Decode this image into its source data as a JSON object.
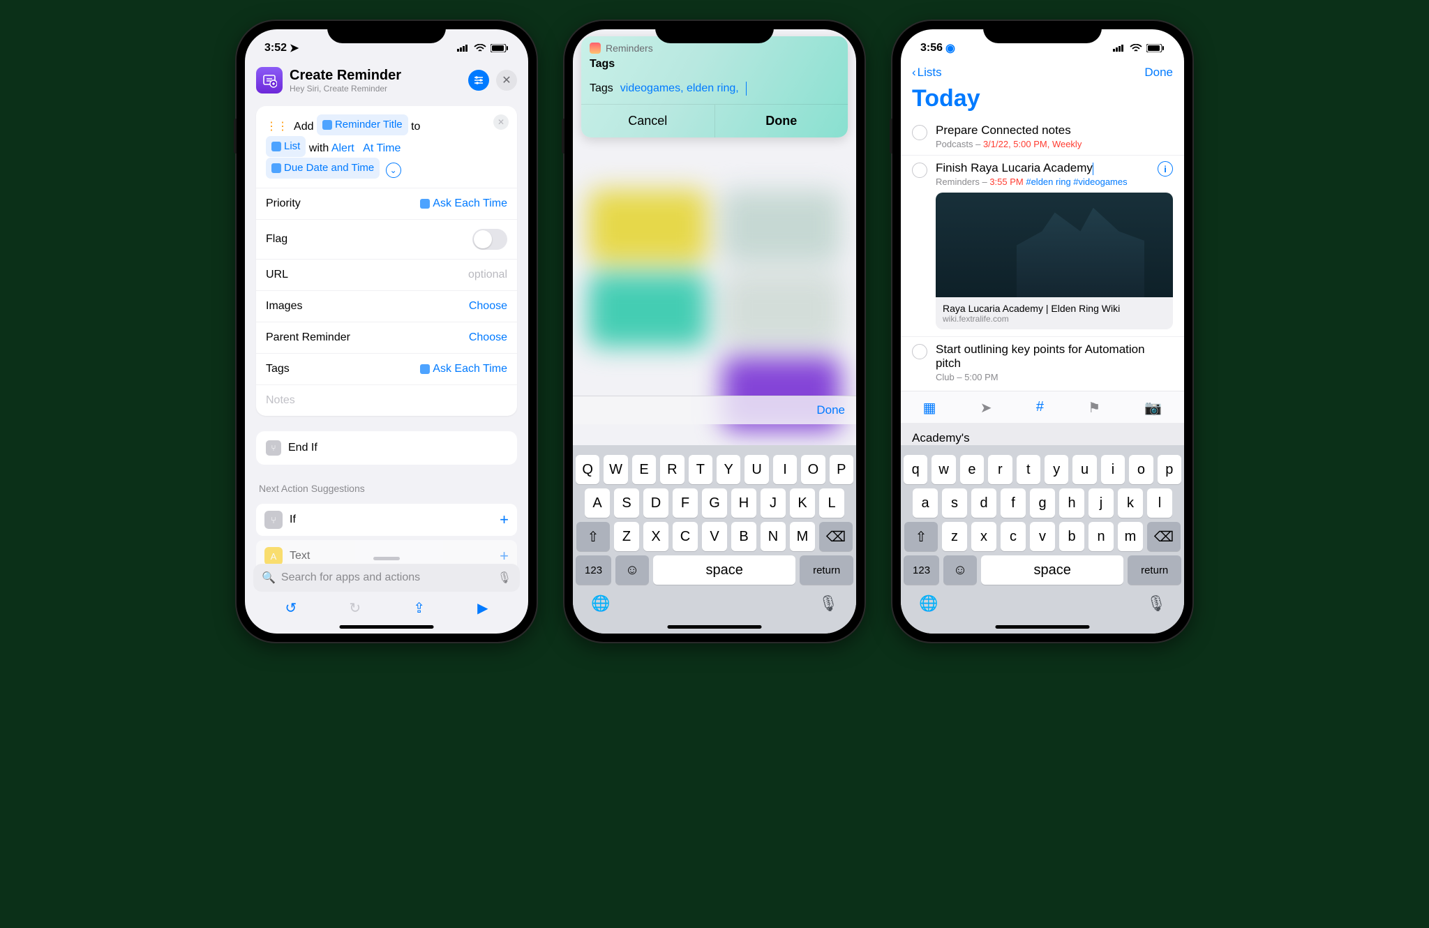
{
  "phone1": {
    "time": "3:52",
    "header": {
      "title": "Create Reminder",
      "subtitle": "Hey Siri, Create Reminder"
    },
    "action": {
      "add": "Add",
      "title_token": "Reminder Title",
      "to": "to",
      "list_token": "List",
      "with": "with",
      "alert": "Alert",
      "at_time": "At Time",
      "due": "Due Date and Time"
    },
    "rows": {
      "priority_label": "Priority",
      "priority_value": "Ask Each Time",
      "flag_label": "Flag",
      "url_label": "URL",
      "url_placeholder": "optional",
      "images_label": "Images",
      "images_value": "Choose",
      "parent_label": "Parent Reminder",
      "parent_value": "Choose",
      "tags_label": "Tags",
      "tags_value": "Ask Each Time",
      "notes_placeholder": "Notes"
    },
    "endif": "End If",
    "next_label": "Next Action Suggestions",
    "suggestions": {
      "if": "If",
      "text": "Text"
    },
    "search_placeholder": "Search for apps and actions"
  },
  "phone2": {
    "sheet": {
      "app": "Reminders",
      "heading": "Tags",
      "field_label": "Tags",
      "field_value": "videogames, elden ring,",
      "cancel": "Cancel",
      "done": "Done"
    },
    "donebar": "Done",
    "keyboard": {
      "row1": [
        "Q",
        "W",
        "E",
        "R",
        "T",
        "Y",
        "U",
        "I",
        "O",
        "P"
      ],
      "row2": [
        "A",
        "S",
        "D",
        "F",
        "G",
        "H",
        "J",
        "K",
        "L"
      ],
      "row3": [
        "Z",
        "X",
        "C",
        "V",
        "B",
        "N",
        "M"
      ],
      "space": "space",
      "return": "return",
      "num": "123"
    }
  },
  "phone3": {
    "time": "3:56",
    "nav": {
      "back": "Lists",
      "done": "Done"
    },
    "heading": "Today",
    "items": [
      {
        "title": "Prepare Connected notes",
        "meta_gray": "Podcasts – ",
        "meta_red": "3/1/22, 5:00 PM, Weekly"
      },
      {
        "title": "Finish Raya Lucaria Academy",
        "meta_gray": "Reminders – ",
        "meta_red": "3:55 PM ",
        "meta_blue": "#elden ring #videogames",
        "link_title": "Raya Lucaria Academy | Elden Ring Wiki",
        "link_sub": "wiki.fextralife.com"
      },
      {
        "title": "Start outlining key points for Automation pitch",
        "meta_gray": "Club – 5:00 PM"
      }
    ],
    "suggestion": "Academy's",
    "keyboard": {
      "row1": [
        "q",
        "w",
        "e",
        "r",
        "t",
        "y",
        "u",
        "i",
        "o",
        "p"
      ],
      "row2": [
        "a",
        "s",
        "d",
        "f",
        "g",
        "h",
        "j",
        "k",
        "l"
      ],
      "row3": [
        "z",
        "x",
        "c",
        "v",
        "b",
        "n",
        "m"
      ],
      "space": "space",
      "return": "return",
      "num": "123"
    }
  }
}
